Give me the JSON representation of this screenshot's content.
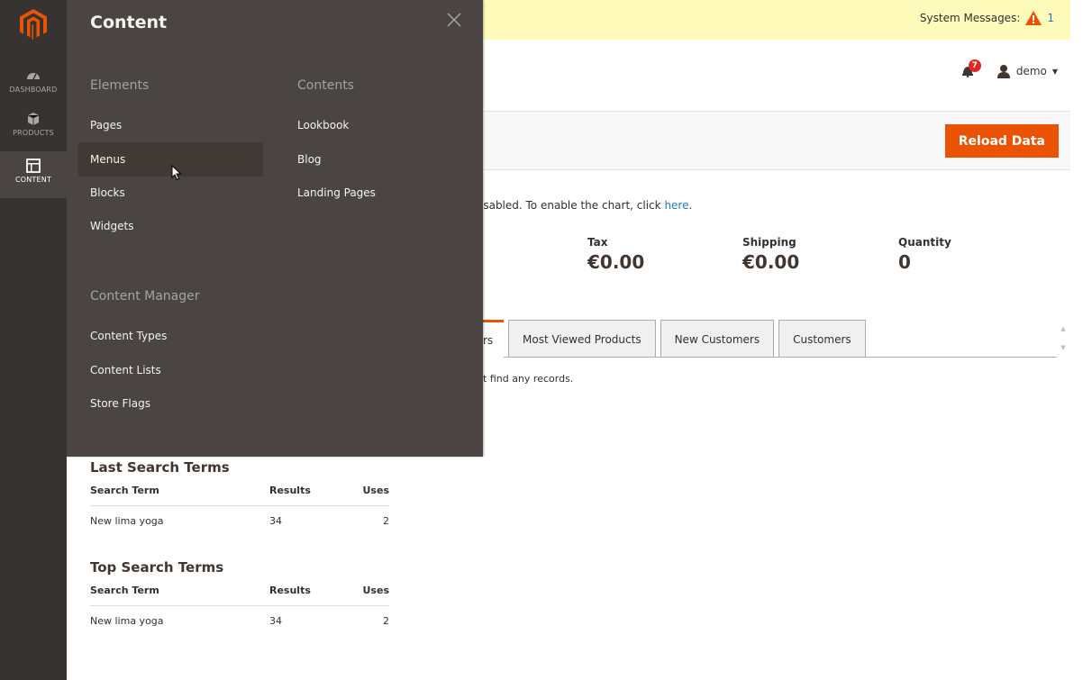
{
  "side_nav": {
    "items": [
      {
        "label": "DASHBOARD",
        "icon": "dashboard-icon"
      },
      {
        "label": "PRODUCTS",
        "icon": "cube-icon"
      },
      {
        "label": "CONTENT",
        "icon": "content-layout-icon"
      }
    ]
  },
  "system_messages": {
    "label": "System Messages:",
    "count": "1"
  },
  "header": {
    "notifications_count": "7",
    "user_name": "demo"
  },
  "page_actions": {
    "reload_label": "Reload Data"
  },
  "dashboard": {
    "chart_note": "isabled. To enable the chart, click",
    "chart_link": "here",
    "chart_note_end": ".",
    "totals": [
      {
        "label": "Tax",
        "value": "€0.00"
      },
      {
        "label": "Shipping",
        "value": "€0.00"
      },
      {
        "label": "Quantity",
        "value": "0"
      }
    ],
    "active_tab_partial": "rs",
    "tabs": [
      "Most Viewed Products",
      "New Customers",
      "Customers"
    ],
    "no_records": "'t find any records.",
    "last_search": {
      "title": "Last Search Terms",
      "columns": [
        "Search Term",
        "Results",
        "Uses"
      ],
      "rows": [
        [
          "New lima yoga",
          "34",
          "2"
        ]
      ]
    },
    "top_search": {
      "title": "Top Search Terms",
      "columns": [
        "Search Term",
        "Results",
        "Uses"
      ],
      "rows": [
        [
          "New lima yoga",
          "34",
          "2"
        ]
      ]
    }
  },
  "flyout": {
    "title": "Content",
    "elements": {
      "title": "Elements",
      "links": [
        "Pages",
        "Menus",
        "Blocks",
        "Widgets"
      ]
    },
    "contents": {
      "title": "Contents",
      "links": [
        "Lookbook",
        "Blog",
        "Landing Pages"
      ]
    },
    "content_manager": {
      "title": "Content Manager",
      "links": [
        "Content Types",
        "Content Lists",
        "Store Flags"
      ]
    }
  },
  "colors": {
    "accent": "#eb5202",
    "nav_bg": "#373330",
    "flyout_bg": "#4a4542",
    "system_bar": "#fffbbb",
    "link": "#1979c3"
  }
}
